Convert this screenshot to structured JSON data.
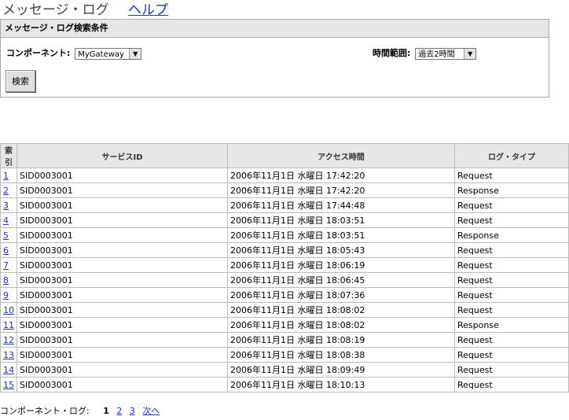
{
  "header": {
    "title": "メッセージ・ログ",
    "help": "ヘルプ"
  },
  "panel": {
    "heading": "メッセージ・ログ検索条件",
    "component_label": "コンポーネント:",
    "component_value": "MyGateway",
    "time_label": "時間範囲:",
    "time_value": "過去2時間",
    "search_button": "検索"
  },
  "table": {
    "headers": [
      "索引",
      "サービスID",
      "アクセス時間",
      "ログ・タイプ"
    ],
    "rows": [
      {
        "idx": "1",
        "sid": "SID0003001",
        "time": "2006年11月1日 水曜日 17:42:20",
        "type": "Request"
      },
      {
        "idx": "2",
        "sid": "SID0003001",
        "time": "2006年11月1日 水曜日 17:42:20",
        "type": "Response"
      },
      {
        "idx": "3",
        "sid": "SID0003001",
        "time": "2006年11月1日 水曜日 17:44:48",
        "type": "Request"
      },
      {
        "idx": "4",
        "sid": "SID0003001",
        "time": "2006年11月1日 水曜日 18:03:51",
        "type": "Request"
      },
      {
        "idx": "5",
        "sid": "SID0003001",
        "time": "2006年11月1日 水曜日 18:03:51",
        "type": "Response"
      },
      {
        "idx": "6",
        "sid": "SID0003001",
        "time": "2006年11月1日 水曜日 18:05:43",
        "type": "Request"
      },
      {
        "idx": "7",
        "sid": "SID0003001",
        "time": "2006年11月1日 水曜日 18:06:19",
        "type": "Request"
      },
      {
        "idx": "8",
        "sid": "SID0003001",
        "time": "2006年11月1日 水曜日 18:06:45",
        "type": "Request"
      },
      {
        "idx": "9",
        "sid": "SID0003001",
        "time": "2006年11月1日 水曜日 18:07:36",
        "type": "Request"
      },
      {
        "idx": "10",
        "sid": "SID0003001",
        "time": "2006年11月1日 水曜日 18:08:02",
        "type": "Request"
      },
      {
        "idx": "11",
        "sid": "SID0003001",
        "time": "2006年11月1日 水曜日 18:08:02",
        "type": "Response"
      },
      {
        "idx": "12",
        "sid": "SID0003001",
        "time": "2006年11月1日 水曜日 18:08:19",
        "type": "Request"
      },
      {
        "idx": "13",
        "sid": "SID0003001",
        "time": "2006年11月1日 水曜日 18:08:38",
        "type": "Request"
      },
      {
        "idx": "14",
        "sid": "SID0003001",
        "time": "2006年11月1日 水曜日 18:09:49",
        "type": "Request"
      },
      {
        "idx": "15",
        "sid": "SID0003001",
        "time": "2006年11月1日 水曜日 18:10:13",
        "type": "Request"
      }
    ]
  },
  "pager": {
    "label": "コンポーネント・ログ:",
    "current": "1",
    "pages": [
      "2",
      "3"
    ],
    "next": "次へ"
  },
  "icons": {
    "dropdown": "chevron-down-icon"
  },
  "colors": {
    "link": "#1a33cc",
    "header_bg": "#e6e6e6",
    "border": "#bbbbbb"
  }
}
